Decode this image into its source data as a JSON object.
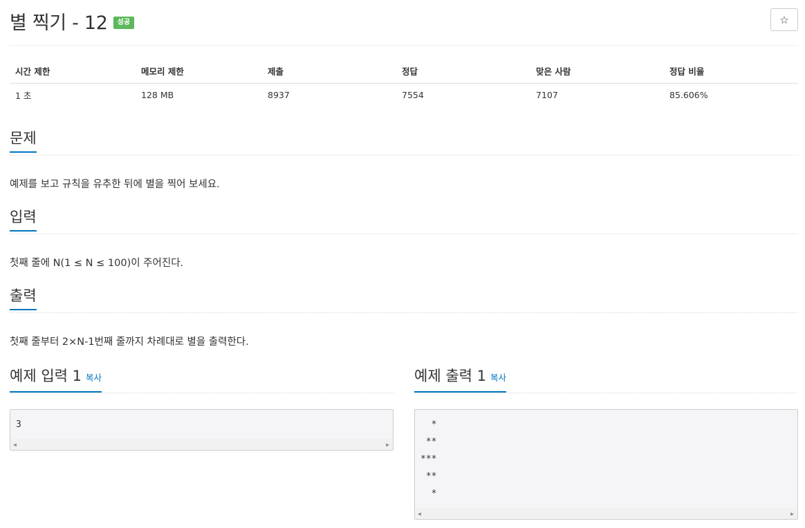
{
  "problem": {
    "title": "별 찍기 - 12",
    "status_badge": "성공",
    "star_button": "☆"
  },
  "info": {
    "headers": [
      "시간 제한",
      "메모리 제한",
      "제출",
      "정답",
      "맞은 사람",
      "정답 비율"
    ],
    "values": [
      "1 초",
      "128 MB",
      "8937",
      "7554",
      "7107",
      "85.606%"
    ]
  },
  "sections": {
    "problem_heading": "문제",
    "problem_text": "예제를 보고 규칙을 유추한 뒤에 별을 찍어 보세요.",
    "input_heading": "입력",
    "input_text": "첫째 줄에 N(1 ≤ N ≤ 100)이 주어진다.",
    "output_heading": "출력",
    "output_text": "첫째 줄부터 2×N-1번째 줄까지 차례대로 별을 출력한다."
  },
  "samples": {
    "input_heading": "예제 입력 1",
    "output_heading": "예제 출력 1",
    "copy_label": "복사",
    "input_lines": [
      "3"
    ],
    "output_lines": [
      "  *",
      " **",
      "***",
      " **",
      "  *"
    ]
  },
  "colors": {
    "accent": "#0076c0",
    "success": "#5cb85c",
    "pre_background": "#f5f5f7"
  }
}
